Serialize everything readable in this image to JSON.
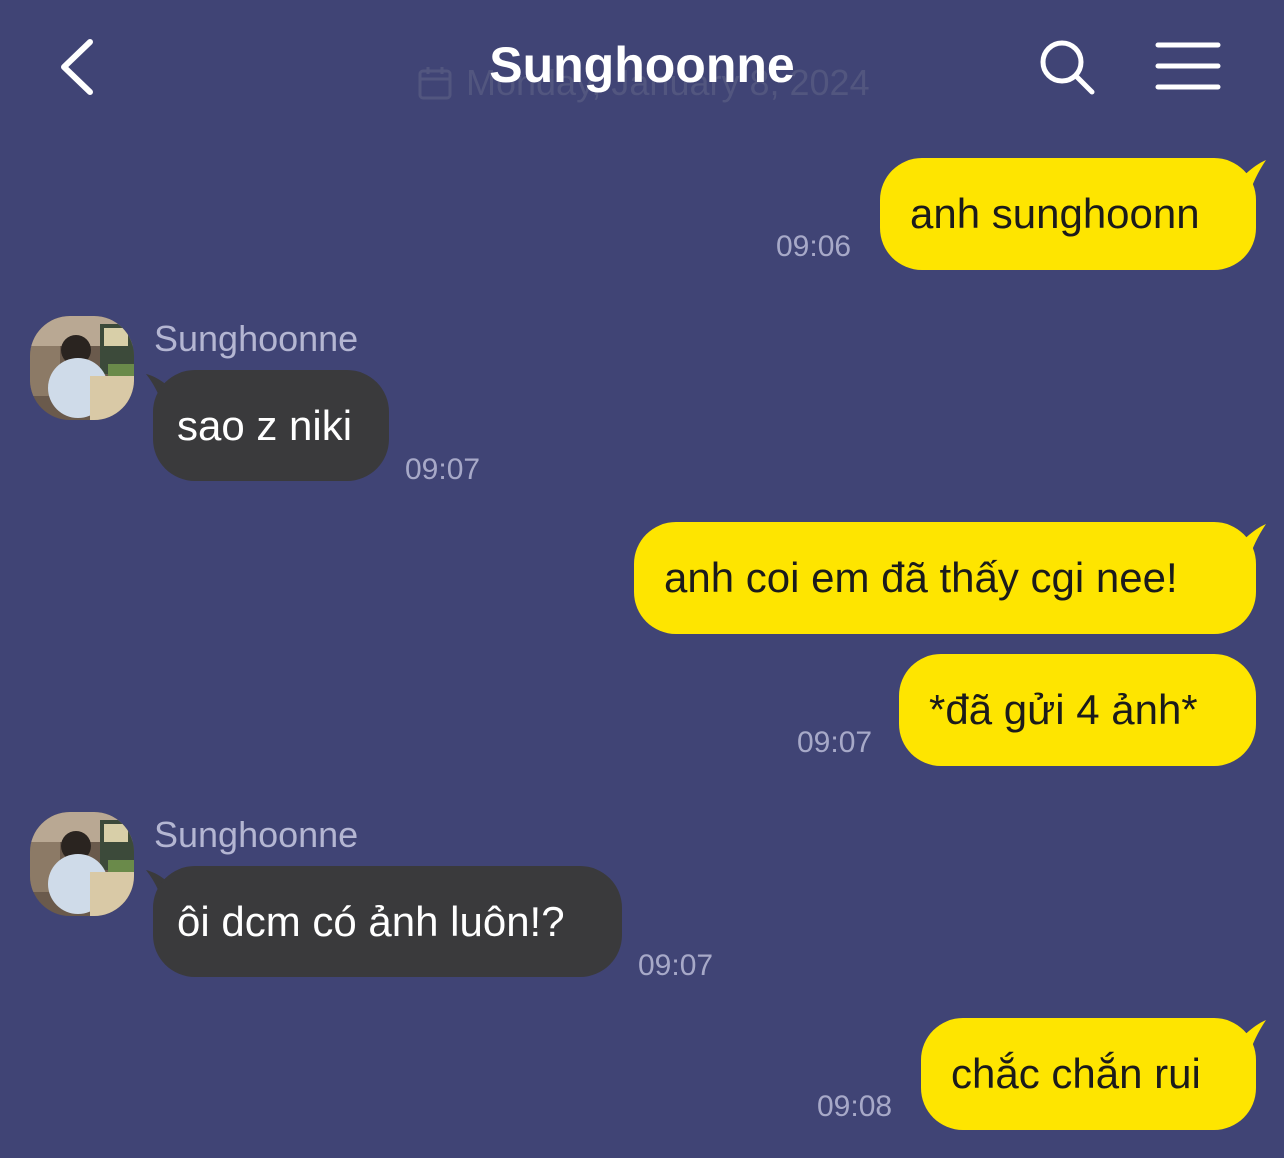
{
  "header": {
    "title": "Sunghoonne",
    "date_ghost": "Monday, January 8, 2024",
    "icons": {
      "back": "chevron-left-icon",
      "search": "search-icon",
      "menu": "hamburger-menu-icon",
      "calendar": "calendar-icon"
    }
  },
  "colors": {
    "background": "#404475",
    "outgoing_bubble": "#fee500",
    "incoming_bubble": "#3a3a3c",
    "timestamp": "#a7a9c8"
  },
  "messages": [
    {
      "direction": "out",
      "text": "anh sunghoonn",
      "time": "09:06"
    },
    {
      "direction": "in",
      "sender": "Sunghoonne",
      "text": "sao z niki",
      "time": "09:07"
    },
    {
      "direction": "out",
      "text": "anh coi em đã thấy cgi nee!",
      "time": ""
    },
    {
      "direction": "out",
      "text": "*đã gửi 4 ảnh*",
      "time": "09:07"
    },
    {
      "direction": "in",
      "sender": "Sunghoonne",
      "text": "ôi dcm có ảnh luôn!?",
      "time": "09:07"
    },
    {
      "direction": "out",
      "text": "chắc chắn rui",
      "time": "09:08"
    }
  ]
}
